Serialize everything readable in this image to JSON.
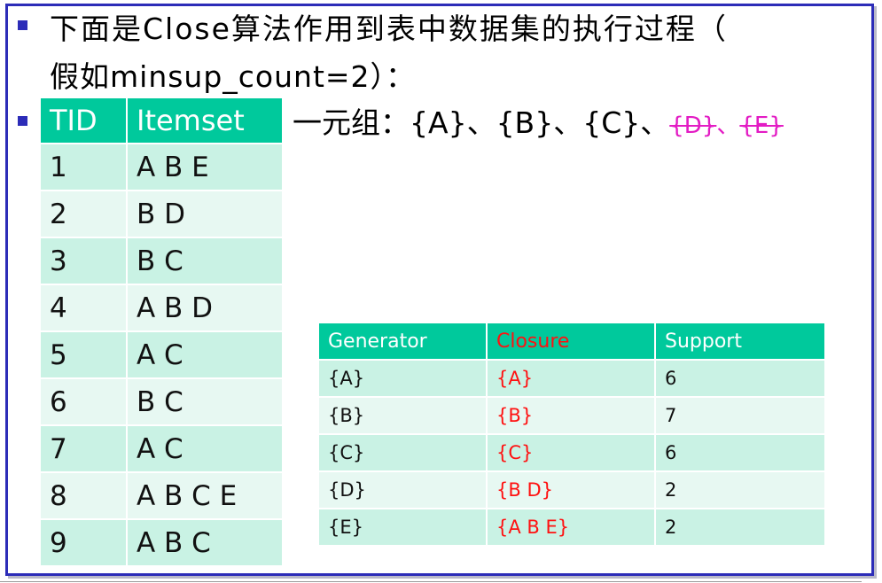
{
  "heading": {
    "line1": "下面是Close算法作用到表中数据集的执行过程（",
    "line2": "假如minsup_count=2）："
  },
  "tid_table": {
    "headers": [
      "TID",
      "Itemset"
    ],
    "rows": [
      [
        "1",
        "A B E"
      ],
      [
        "2",
        "B D"
      ],
      [
        "3",
        "B C"
      ],
      [
        "4",
        "A B D"
      ],
      [
        "5",
        "A C"
      ],
      [
        "6",
        "B C"
      ],
      [
        "7",
        "A C"
      ],
      [
        "8",
        "A B C E"
      ],
      [
        "9",
        "A B C"
      ]
    ]
  },
  "one_tuple": {
    "label": "一元组：{A}、{B}、{C}、",
    "struck_d": "{D}",
    "sep": "、",
    "struck_e": "{E}"
  },
  "generator_table": {
    "headers": [
      "Generator",
      "Closure",
      "Support"
    ],
    "rows": [
      [
        "{A}",
        "{A}",
        "6"
      ],
      [
        "{B}",
        "{B}",
        "7"
      ],
      [
        "{C}",
        "{C}",
        "6"
      ],
      [
        "{D}",
        "{B D}",
        "2"
      ],
      [
        "{E}",
        "{A B E}",
        "2"
      ]
    ]
  },
  "colors": {
    "bullet": "#2c2cb8",
    "header_bg": "#00c99c",
    "row_odd": "#c9f2e4",
    "row_even": "#e7f8f2",
    "strike": "#e31cc4",
    "closure": "#ff1111"
  }
}
